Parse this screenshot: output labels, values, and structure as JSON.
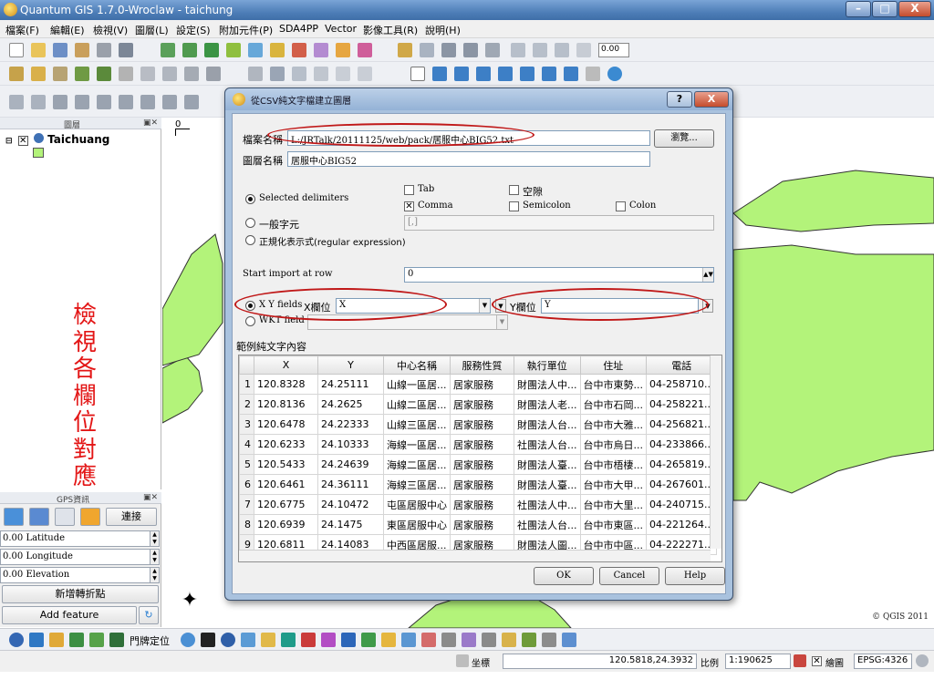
{
  "window": {
    "title": "Quantum GIS 1.7.0-Wroclaw - taichung"
  },
  "menu": [
    "檔案(F)",
    "編輯(E)",
    "檢視(V)",
    "圖層(L)",
    "設定(S)",
    "附加元件(P)",
    "SDA4PP",
    "Vector",
    "影像工具(R)",
    "說明(H)"
  ],
  "toolbar": {
    "scale_value": "0.00"
  },
  "layers_panel": {
    "title": "圖層",
    "layer_name": "Taichuang"
  },
  "annotation": {
    "text": "檢視各欄位對應正確與否",
    "color": "#e31616"
  },
  "gps_panel": {
    "title": "GPS資訊",
    "connect_label": "連接",
    "latitude": "0.00 Latitude",
    "longitude": "0.00 Longitude",
    "elevation": "0.00 Elevation",
    "add_vertex_label": "新增轉折點",
    "add_feature_label": "Add feature"
  },
  "map": {
    "ruler_label": "0",
    "copyright": "© QGIS 2011",
    "polygon_color": "#b3f37a"
  },
  "bottom_toolbar": {
    "door_locate_label": "門牌定位"
  },
  "status": {
    "coord_label": "坐標",
    "coord_value": "120.5818,24.3932",
    "scale_label": "比例",
    "scale_value": "1:190625",
    "render_label": "繪圖",
    "crs": "EPSG:4326"
  },
  "dialog": {
    "title": "從CSV純文字檔建立圖層",
    "help_btn": "?",
    "close_btn": "X",
    "filename_label": "檔案名稱",
    "filename_value": "L:/JRTalk/20111125/web/pack/居服中心BIG52.txt",
    "browse_label": "瀏覽...",
    "layername_label": "圖層名稱",
    "layername_value": "居服中心BIG52",
    "delim_selected_label": "Selected delimiters",
    "delim_plain_label": "一般字元",
    "delim_regex_label": "正規化表示式(regular expression)",
    "delim_tab": "Tab",
    "delim_comma": "Comma",
    "delim_space": "空隙",
    "delim_semicolon": "Semicolon",
    "delim_colon": "Colon",
    "delim_plain_value": "[,]",
    "start_row_label": "Start import at row",
    "start_row_value": "0",
    "xy_fields_label": "X Y fields",
    "x_field_label": "X欄位",
    "x_field_value": "X",
    "y_field_label": "Y欄位",
    "y_field_value": "Y",
    "wkt_label": "WKT field",
    "sample_label": "範例純文字內容",
    "ok_label": "OK",
    "cancel_label": "Cancel",
    "help_label": "Help",
    "table": {
      "columns": [
        "X",
        "Y",
        "中心名稱",
        "服務性質",
        "執行單位",
        "住址",
        "電話"
      ],
      "rows": [
        [
          "1",
          "120.8328",
          "24.25111",
          "山線一區居...",
          "居家服務",
          "財團法人中...",
          "台中市東勢...",
          "04-258710..."
        ],
        [
          "2",
          "120.8136",
          "24.2625",
          "山線二區居...",
          "居家服務",
          "財團法人老...",
          "台中市石岡...",
          "04-258221..."
        ],
        [
          "3",
          "120.6478",
          "24.22333",
          "山線三區居...",
          "居家服務",
          "財團法人台...",
          "台中市大雅...",
          "04-256821..."
        ],
        [
          "4",
          "120.6233",
          "24.10333",
          "海線一區居...",
          "居家服務",
          "社團法人台...",
          "台中市烏日...",
          "04-233866..."
        ],
        [
          "5",
          "120.5433",
          "24.24639",
          "海線二區居...",
          "居家服務",
          "財團法人臺...",
          "台中市梧棲...",
          "04-265819..."
        ],
        [
          "6",
          "120.6461",
          "24.36111",
          "海線三區居...",
          "居家服務",
          "財團法人臺...",
          "台中市大甲...",
          "04-267601..."
        ],
        [
          "7",
          "120.6775",
          "24.10472",
          "屯區居服中心",
          "居家服務",
          "社團法人中...",
          "台中市大里...",
          "04-240715..."
        ],
        [
          "8",
          "120.6939",
          "24.1475",
          "東區居服中心",
          "居家服務",
          "社團法人台...",
          "台中市東區...",
          "04-221264..."
        ],
        [
          "9",
          "120.6811",
          "24.14083",
          "中西區居服...",
          "居家服務",
          "財團法人圖...",
          "台中市中區...",
          "04-222271..."
        ]
      ]
    }
  }
}
